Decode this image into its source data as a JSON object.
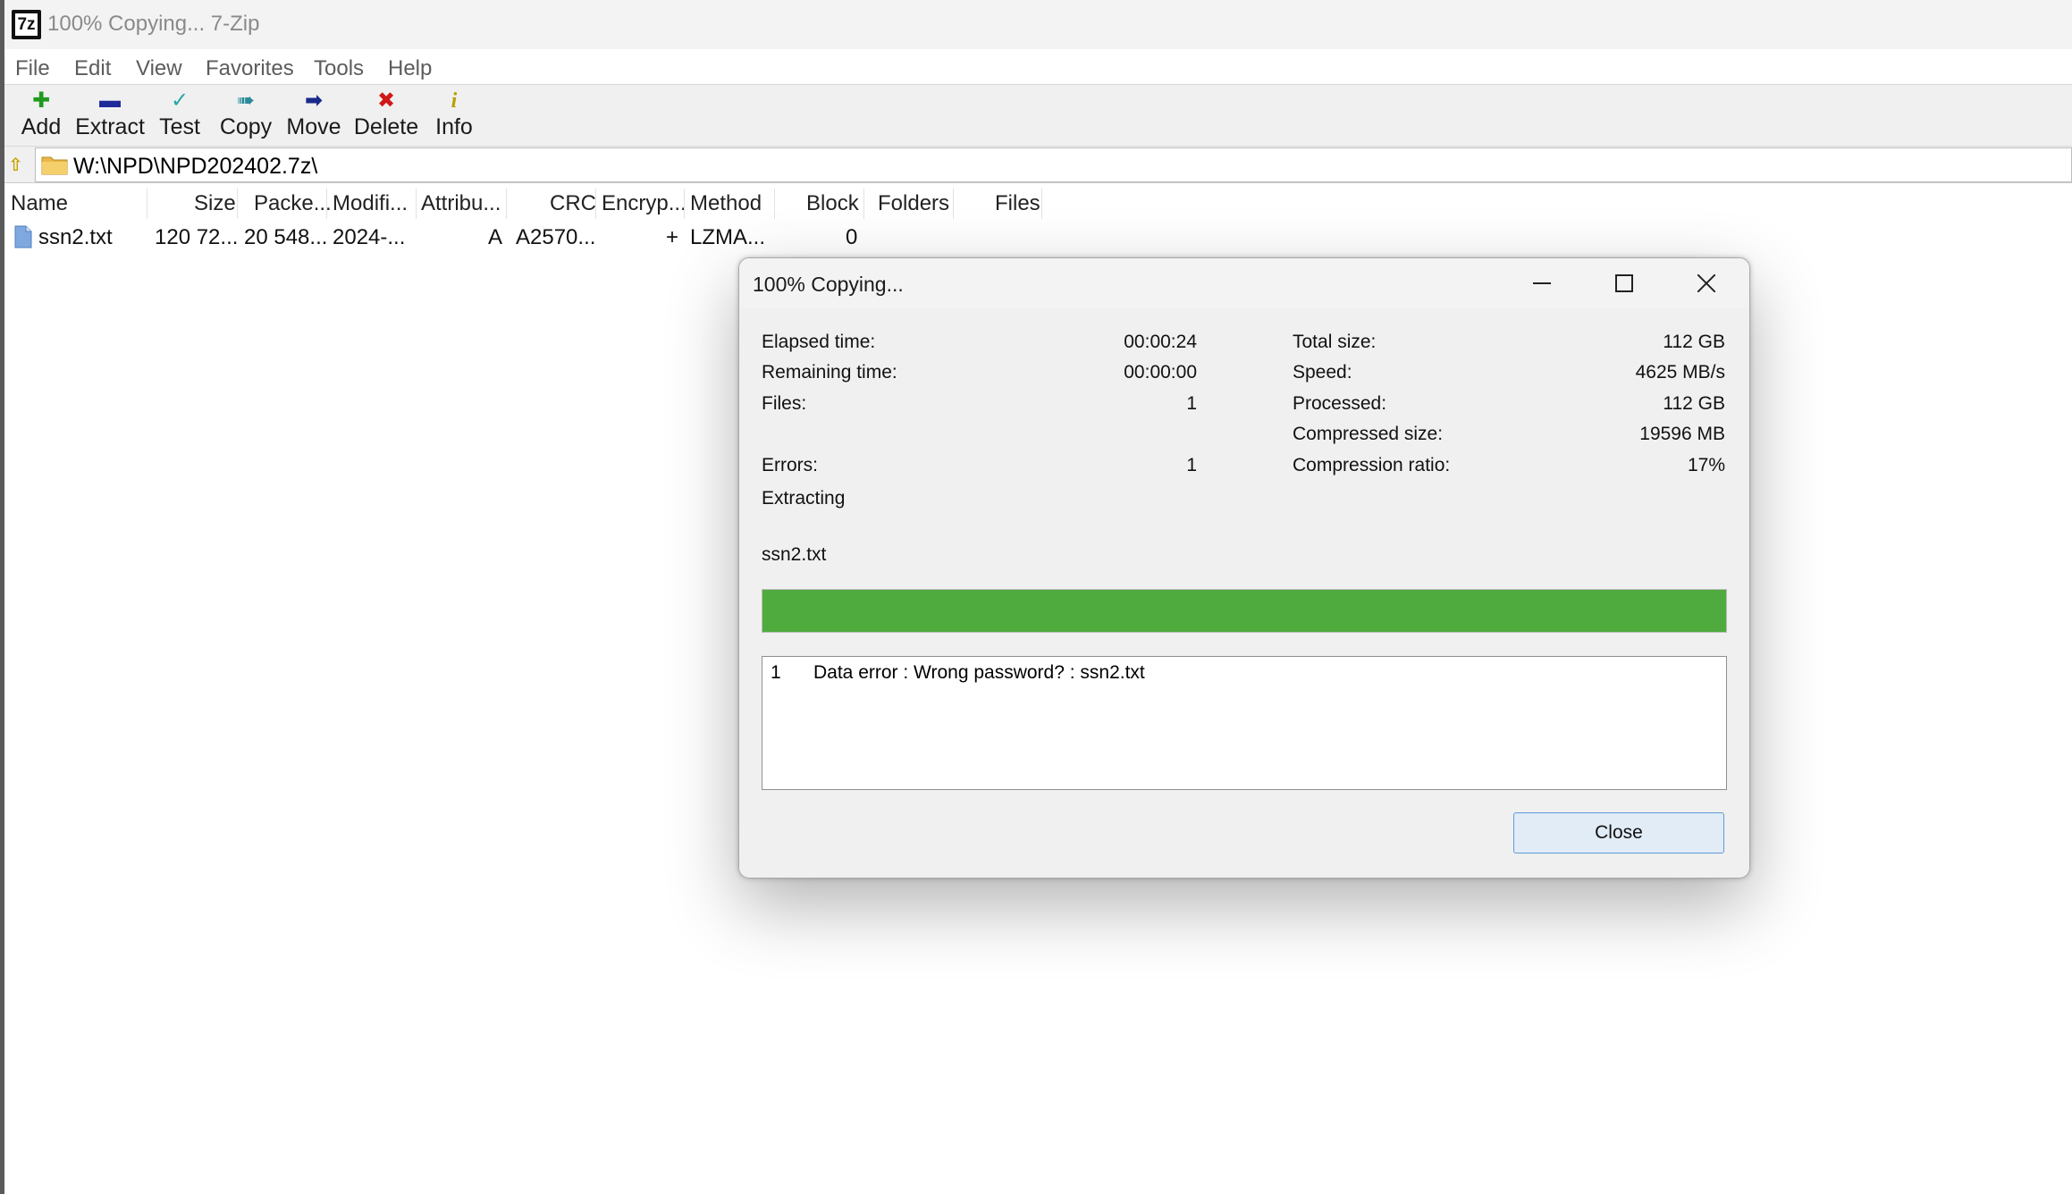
{
  "window": {
    "icon_text": "7z",
    "title": "100% Copying... 7-Zip"
  },
  "menu": [
    "File",
    "Edit",
    "View",
    "Favorites",
    "Tools",
    "Help"
  ],
  "toolbar": [
    {
      "label": "Add",
      "icon": "plus-icon",
      "color": "#1f9a1f"
    },
    {
      "label": "Extract",
      "icon": "minus-icon",
      "color": "#1f2a9a"
    },
    {
      "label": "Test",
      "icon": "check-icon",
      "color": "#2aa6a6"
    },
    {
      "label": "Copy",
      "icon": "double-arrow-right-icon",
      "color": "#2a8a9a"
    },
    {
      "label": "Move",
      "icon": "arrow-right-icon",
      "color": "#1a2a8a"
    },
    {
      "label": "Delete",
      "icon": "x-icon",
      "color": "#d01818"
    },
    {
      "label": "Info",
      "icon": "info-icon",
      "color": "#b8a000"
    }
  ],
  "address": {
    "path": "W:\\NPD\\NPD202402.7z\\"
  },
  "columns": [
    "Name",
    "Size",
    "Packe...",
    "Modifi...",
    "Attribu...",
    "CRC",
    "Encryp...",
    "Method",
    "Block",
    "Folders",
    "Files"
  ],
  "rows": [
    {
      "name": "ssn2.txt",
      "size": "120 72...",
      "packed": "20 548...",
      "modified": "2024-...",
      "attributes": "A",
      "crc": "A2570...",
      "encrypted": "+",
      "method": "LZMA...",
      "block": "0",
      "folders": "",
      "files": ""
    }
  ],
  "dialog": {
    "title": "100% Copying...",
    "left_stats": [
      {
        "label": "Elapsed time:",
        "value": "00:00:24"
      },
      {
        "label": "Remaining time:",
        "value": "00:00:00"
      },
      {
        "label": "Files:",
        "value": "1"
      },
      {
        "label": "Errors:",
        "value": "1"
      }
    ],
    "right_stats": [
      {
        "label": "Total size:",
        "value": "112 GB"
      },
      {
        "label": "Speed:",
        "value": "4625 MB/s"
      },
      {
        "label": "Processed:",
        "value": "112 GB"
      },
      {
        "label": "Compressed size:",
        "value": "19596 MB"
      },
      {
        "label": "Compression ratio:",
        "value": "17%"
      }
    ],
    "status": "Extracting",
    "current_file": "ssn2.txt",
    "progress": 1.0,
    "progress_color": "#4fab3e",
    "errors": [
      {
        "num": "1",
        "message": "Data error : Wrong password? : ssn2.txt"
      }
    ],
    "close_label": "Close"
  }
}
